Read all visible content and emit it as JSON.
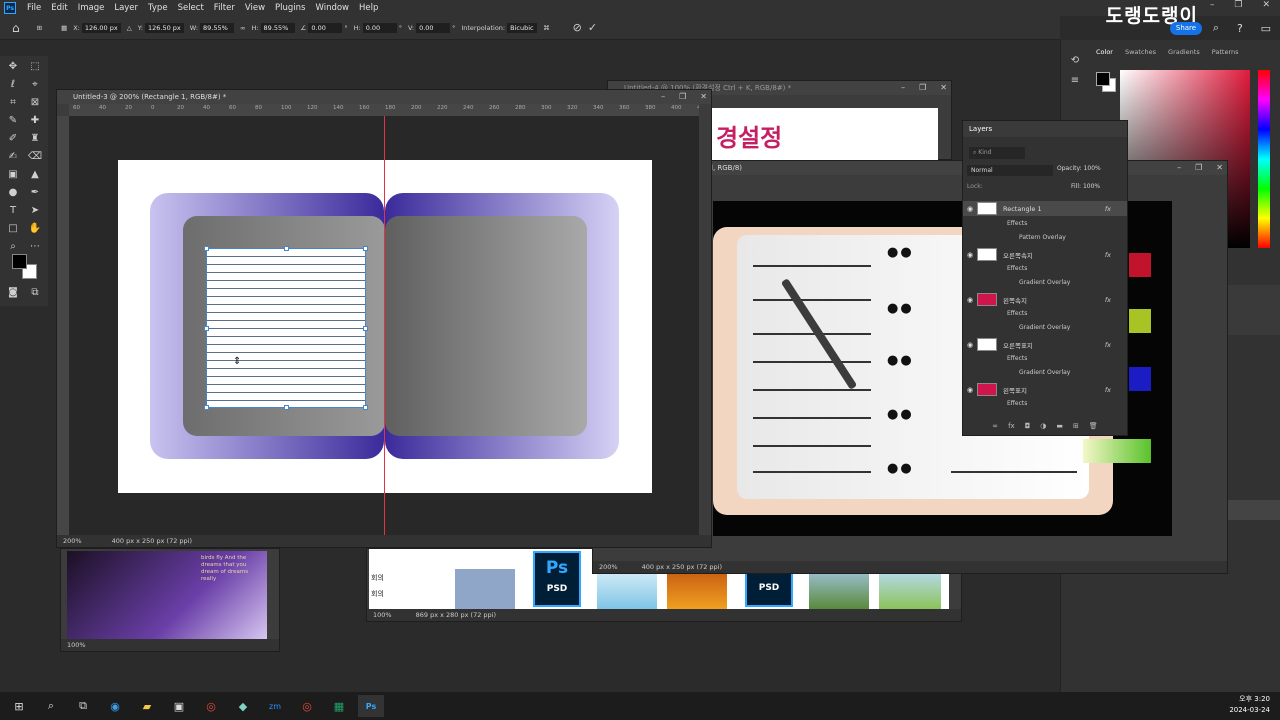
{
  "menubar": {
    "items": [
      "File",
      "Edit",
      "Image",
      "Layer",
      "Type",
      "Select",
      "Filter",
      "View",
      "Plugins",
      "Window",
      "Help"
    ]
  },
  "watermark": "도랭도랭이",
  "share_label": "Share",
  "options": {
    "x": "126.00 px",
    "y": "126.50 px",
    "w": "89.55%",
    "h": "89.55%",
    "angle": "0.00",
    "hskew": "0.00",
    "vskew": "0.00",
    "x_label": "X:",
    "y_label": "Y:",
    "w_label": "W:",
    "h_label": "H:",
    "h2_label": "H:",
    "v_label": "V:",
    "degree": "°",
    "interp_label": "Interpolation:",
    "interp_value": "Bicubic"
  },
  "doc1": {
    "title": "Untitled-3 @ 200% (Rectangle 1, RGB/8#) *",
    "zoom": "200%",
    "info": "400 px x 250 px (72 ppi)",
    "ruler": [
      "60",
      "40",
      "20",
      "0",
      "20",
      "40",
      "60",
      "80",
      "100",
      "120",
      "140",
      "160",
      "180",
      "200",
      "220",
      "240",
      "260",
      "280",
      "300",
      "320",
      "340",
      "360",
      "380",
      "400",
      "420"
    ]
  },
  "doc2": {
    "title": "Untitled-4 @ 100% (환경설정 Ctrl + K, RGB/8#) *",
    "text": "경설정"
  },
  "doc3": {
    "title": "l, RGB/8)",
    "zoom": "200%",
    "info": "400 px x 250 px (72 ppi)"
  },
  "doc4": {
    "zoom": "100%",
    "info": "869 px x 280 px (72 ppi)",
    "text1": "회의",
    "text2": "회의",
    "psd": "PSD",
    "ps": "Ps"
  },
  "doc5": {
    "zoom": "100%",
    "text": "birds fly And the dreams that you dream of dreams really"
  },
  "color_tabs": [
    "Color",
    "Swatches",
    "Gradients",
    "Patterns"
  ],
  "layers": {
    "title": "Layers",
    "kind": "Kind",
    "blend": "Normal",
    "opacity_label": "Opacity:",
    "opacity": "100%",
    "lock_label": "Lock:",
    "fill_label": "Fill:",
    "fill": "100%",
    "rows": [
      {
        "name": "Rectangle 1",
        "effects": "Effects",
        "effect": "Pattern Overlay"
      },
      {
        "name": "오른쪽속지",
        "effects": "Effects",
        "effect": "Gradient Overlay"
      },
      {
        "name": "왼쪽속지",
        "effects": "Effects",
        "effect": "Gradient Overlay"
      },
      {
        "name": "오른쪽표지",
        "effects": "Effects",
        "effect": "Gradient Overlay"
      },
      {
        "name": "왼쪽표지",
        "effects": "Effects",
        "effect": ""
      }
    ]
  },
  "clock": {
    "time": "오후 3:20",
    "date": "2024-03-24"
  },
  "colors": {
    "accent": "#1473e6",
    "guide": "#e2334d",
    "cover": "#3b2a9b"
  }
}
